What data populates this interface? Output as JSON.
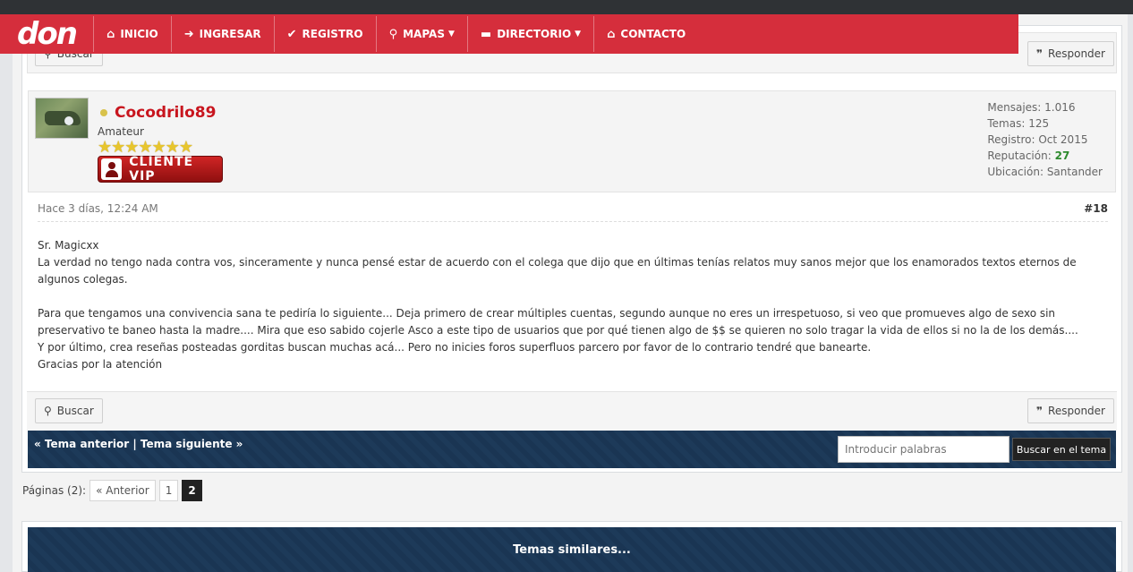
{
  "nav": {
    "logo": "don",
    "items": [
      {
        "label": "INICIO",
        "icon": "home-icon"
      },
      {
        "label": "INGRESAR",
        "icon": "login-icon"
      },
      {
        "label": "REGISTRO",
        "icon": "check-icon"
      },
      {
        "label": "MAPAS",
        "icon": "map-marker-icon"
      },
      {
        "label": "DIRECTORIO",
        "icon": "folder-icon"
      },
      {
        "label": "CONTACTO",
        "icon": "bank-icon"
      }
    ]
  },
  "toolbar": {
    "search_label": "Buscar",
    "reply_label": "Responder"
  },
  "post": {
    "username": "Cocodrilo89",
    "rank": "Amateur",
    "badge": "CLIENTE VIP",
    "stats": {
      "mensajes_label": "Mensajes:",
      "mensajes": "1.016",
      "temas_label": "Temas:",
      "temas": "125",
      "registro_label": "Registro:",
      "registro": "Oct 2015",
      "reputacion_label": "Reputación:",
      "reputacion": "27",
      "ubicacion_label": "Ubicación:",
      "ubicacion": "Santander"
    },
    "timestamp": "Hace 3 días, 12:24 AM",
    "number": "#18",
    "body": [
      "Sr. Magicxx",
      "La verdad no tengo nada contra vos, sinceramente y nunca pensé estar de acuerdo con el colega que dijo que en últimas tenías relatos muy sanos mejor que los enamorados textos eternos de algunos colegas.",
      "",
      "Para que tengamos una convivencia sana te pediría lo siguiente... Deja primero de crear múltiples cuentas, segundo aunque no eres un irrespetuoso, si veo que promueves algo de sexo sin preservativo te baneo hasta la madre.... Mira que eso sabido cojerle Asco a este tipo de usuarios que por qué tienen algo de $$ se quieren no solo tragar la vida de ellos si no la de los demás....",
      "Y por último, crea reseñas posteadas gorditas buscan muchas acá... Pero no inicies foros superfluos parcero por favor de lo contrario tendré que banearte.",
      "Gracias por la atención"
    ]
  },
  "thread_nav": {
    "prev": "« Tema anterior",
    "separator": "|",
    "next": "Tema siguiente »",
    "search_placeholder": "Introducir palabras",
    "search_button": "Buscar en el tema"
  },
  "pagination": {
    "label": "Páginas (2):",
    "prev": "« Anterior",
    "pages": [
      "1",
      "2"
    ],
    "current": "2"
  },
  "similar": {
    "title": "Temas similares..."
  }
}
